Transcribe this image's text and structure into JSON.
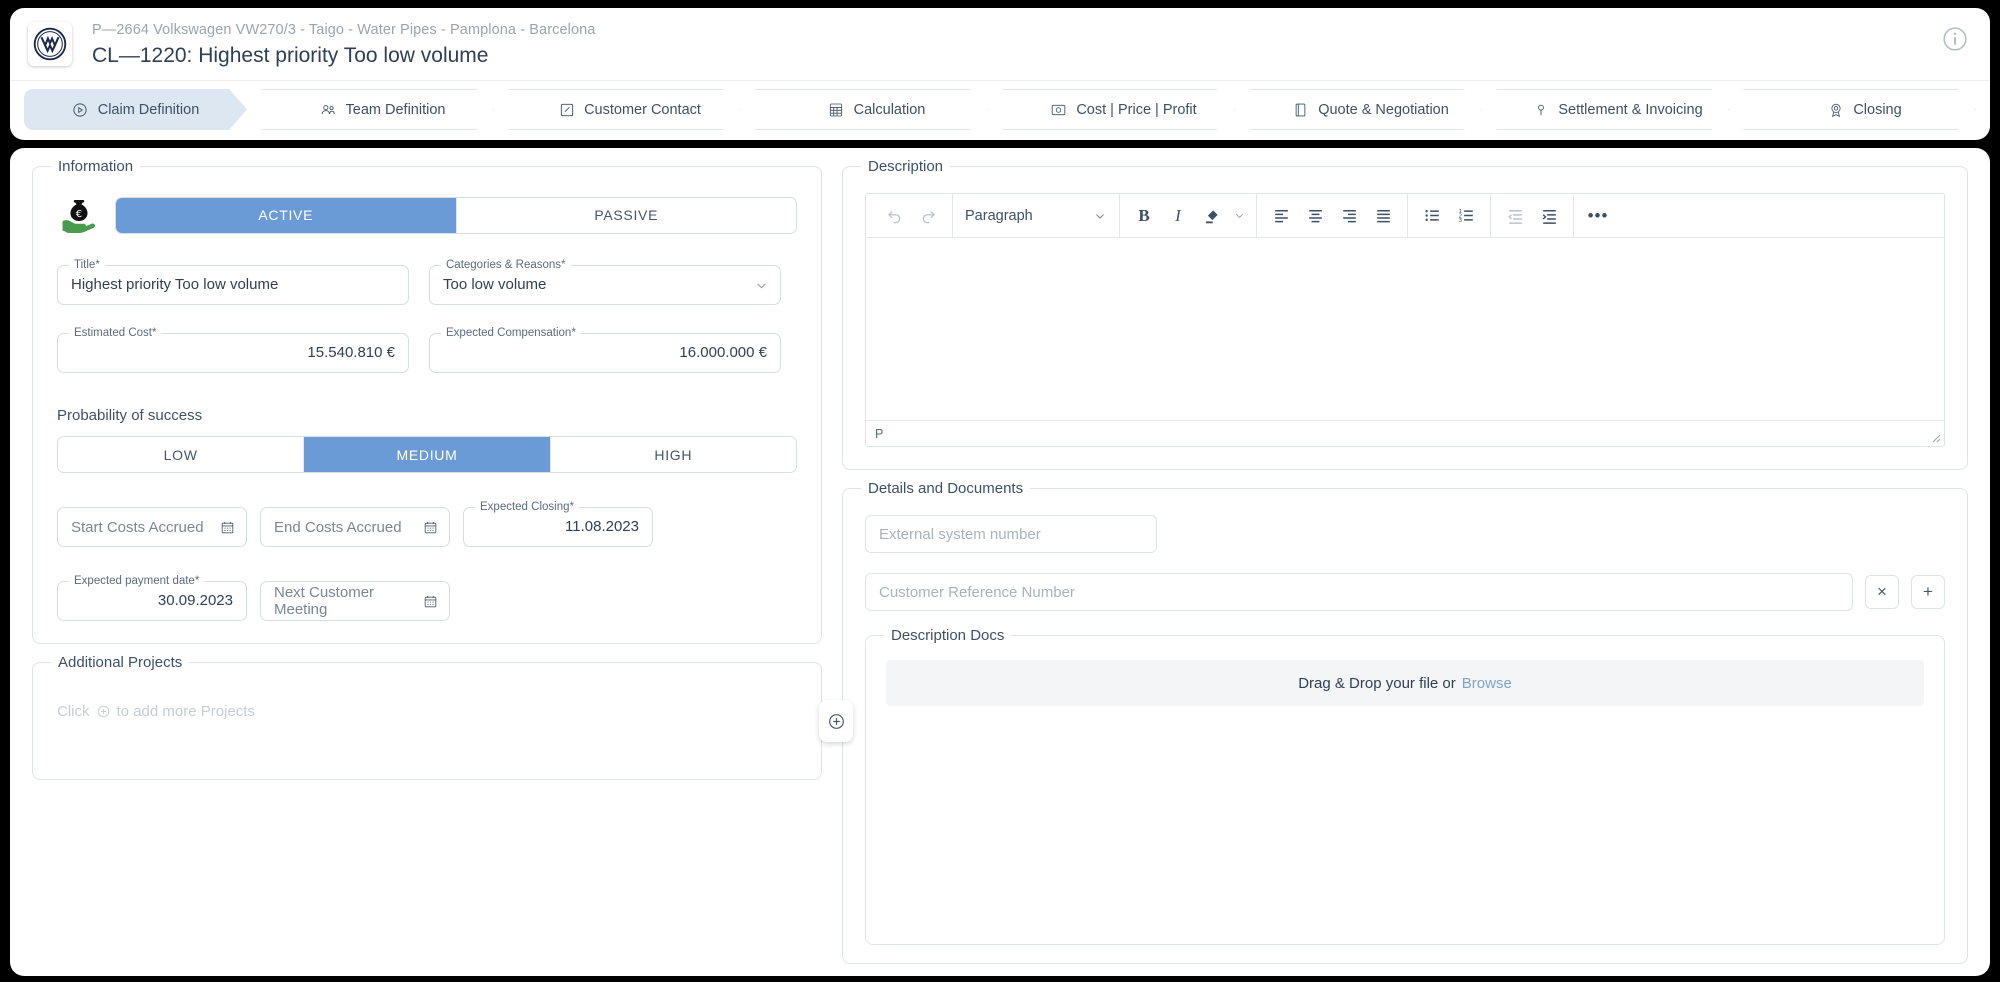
{
  "header": {
    "logo_alt": "Volkswagen",
    "breadcrumb": "P—2664 Volkswagen VW270/3 - Taigo - Water Pipes - Pamplona - Barcelona",
    "title": "CL—1220: Highest priority Too low volume",
    "info_icon": "info-circle-icon"
  },
  "tabs": [
    {
      "label": "Claim Definition",
      "icon": "target-icon",
      "active": true
    },
    {
      "label": "Team Definition",
      "icon": "people-icon",
      "active": false
    },
    {
      "label": "Customer Contact",
      "icon": "contact-card-icon",
      "active": false
    },
    {
      "label": "Calculation",
      "icon": "calculator-icon",
      "active": false
    },
    {
      "label": "Cost | Price | Profit",
      "icon": "coin-icon",
      "active": false
    },
    {
      "label": "Quote & Negotiation",
      "icon": "document-icon",
      "active": false
    },
    {
      "label": "Settlement & Invoicing",
      "icon": "pin-icon",
      "active": false
    },
    {
      "label": "Closing",
      "icon": "seal-icon",
      "active": false
    }
  ],
  "information": {
    "legend": "Information",
    "money_icon": "money-bag-hand-icon",
    "status_toggle": {
      "options": [
        "ACTIVE",
        "PASSIVE"
      ],
      "selected": "ACTIVE"
    },
    "title_field": {
      "label": "Title",
      "required": "*",
      "value": "Highest priority Too low volume"
    },
    "category_field": {
      "label": "Categories & Reasons",
      "required": "*",
      "value": "Too low volume",
      "caret_icon": "chevron-down-icon"
    },
    "estimated_cost": {
      "label": "Estimated Cost",
      "required": "*",
      "value": "15.540.810 €"
    },
    "expected_compensation": {
      "label": "Expected Compensation",
      "required": "*",
      "value": "16.000.000 €"
    },
    "probability": {
      "label": "Probability of success",
      "options": [
        "LOW",
        "MEDIUM",
        "HIGH"
      ],
      "selected": "MEDIUM"
    },
    "start_costs_accrued": {
      "placeholder": "Start Costs Accrued",
      "value": "",
      "icon": "calendar-icon"
    },
    "end_costs_accrued": {
      "placeholder": "End Costs Accrued",
      "value": "",
      "icon": "calendar-icon"
    },
    "expected_closing": {
      "label": "Expected Closing",
      "required": "*",
      "value": "11.08.2023"
    },
    "expected_payment_date": {
      "label": "Expected payment date",
      "required": "*",
      "value": "30.09.2023"
    },
    "next_customer_meeting": {
      "placeholder": "Next Customer Meeting",
      "value": "",
      "icon": "calendar-icon"
    }
  },
  "additional_projects": {
    "legend": "Additional Projects",
    "hint_before": "Click",
    "hint_after": "to add more Projects",
    "hint_icon": "plus-circle-icon",
    "add_button_icon": "plus-circle-icon"
  },
  "description": {
    "legend": "Description",
    "toolbar": {
      "undo": "undo-icon",
      "redo": "redo-icon",
      "block_format": "Paragraph",
      "block_caret": "chevron-down-icon",
      "bold": "B",
      "italic": "I",
      "highlight": "highlighter-icon",
      "highlight_caret": "chevron-down-icon",
      "align_left": "align-left-icon",
      "align_center": "align-center-icon",
      "align_right": "align-right-icon",
      "align_justify": "align-justify-icon",
      "bullet_list": "bullet-list-icon",
      "numbered_list": "numbered-list-icon",
      "outdent": "outdent-icon",
      "indent": "indent-icon",
      "more": "•••"
    },
    "body_text": "",
    "status_path": "P",
    "resize_icon": "resize-grip-icon"
  },
  "details": {
    "legend": "Details and Documents",
    "external_system_number": {
      "placeholder": "External system number",
      "value": ""
    },
    "customer_reference_number": {
      "placeholder": "Customer Reference Number",
      "value": ""
    },
    "clear_button": "×",
    "add_button": "+",
    "docs": {
      "legend": "Description Docs",
      "drop_text": "Drag & Drop your file or",
      "browse_label": "Browse"
    }
  },
  "colors": {
    "accent_blue": "#6b9bd6",
    "tab_active_bg": "#dde7f2",
    "text_dark": "#2f4055",
    "muted": "#9aa4b0",
    "border": "#dfe4ea",
    "link_blue": "#7da3cf",
    "green": "#4a9a4f"
  }
}
